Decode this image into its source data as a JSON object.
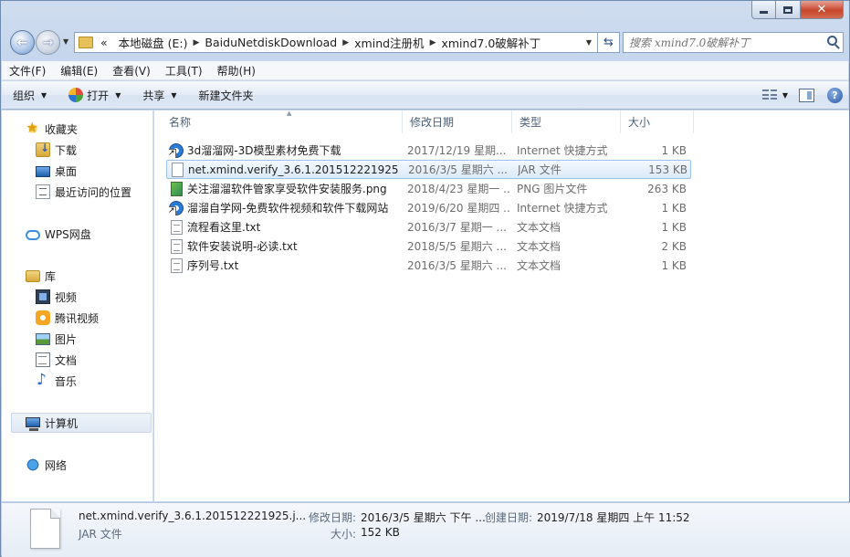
{
  "window": {
    "caption_min": "",
    "caption_max": "",
    "caption_close": "✕"
  },
  "address": {
    "overflow": "«",
    "segments": [
      "本地磁盘 (E:)",
      "BaiduNetdiskDownload",
      "xmind注册机",
      "xmind7.0破解补丁"
    ]
  },
  "search": {
    "placeholder": "搜索 xmind7.0破解补丁"
  },
  "menu": [
    "文件(F)",
    "编辑(E)",
    "查看(V)",
    "工具(T)",
    "帮助(H)"
  ],
  "toolbar": {
    "organize": "组织",
    "open": "打开",
    "share": "共享",
    "new_folder": "新建文件夹",
    "help": "?"
  },
  "navpane": {
    "favorites": "收藏夹",
    "downloads": "下载",
    "desktop": "桌面",
    "recent": "最近访问的位置",
    "wps": "WPS网盘",
    "libraries": "库",
    "videos": "视频",
    "tencent_video": "腾讯视频",
    "pictures": "图片",
    "documents": "文档",
    "music": "音乐",
    "computer": "计算机",
    "network": "网络"
  },
  "columns": {
    "name": "名称",
    "date": "修改日期",
    "type": "类型",
    "size": "大小"
  },
  "files": [
    {
      "name": "3d溜溜网-3D模型素材免费下载",
      "date": "2017/12/19 星期...",
      "type": "Internet 快捷方式",
      "size": "1 KB",
      "icon": "url-shortcut-icon"
    },
    {
      "name": "net.xmind.verify_3.6.1.201512221925.j...",
      "date": "2016/3/5 星期六 ...",
      "type": "JAR 文件",
      "size": "153 KB",
      "icon": "jar-file-icon"
    },
    {
      "name": "关注溜溜软件管家享受软件安装服务.png",
      "date": "2018/4/23 星期一 ...",
      "type": "PNG 图片文件",
      "size": "263 KB",
      "icon": "png-file-icon"
    },
    {
      "name": "溜溜自学网-免费软件视频和软件下载网站",
      "date": "2019/6/20 星期四 ...",
      "type": "Internet 快捷方式",
      "size": "1 KB",
      "icon": "url-shortcut-icon"
    },
    {
      "name": "流程看这里.txt",
      "date": "2016/3/7 星期一 ...",
      "type": "文本文档",
      "size": "1 KB",
      "icon": "txt-file-icon"
    },
    {
      "name": "软件安装说明-必读.txt",
      "date": "2018/5/5 星期六 ...",
      "type": "文本文档",
      "size": "2 KB",
      "icon": "txt-file-icon"
    },
    {
      "name": "序列号.txt",
      "date": "2016/3/5 星期六 ...",
      "type": "文本文档",
      "size": "1 KB",
      "icon": "txt-file-icon"
    }
  ],
  "details": {
    "filename": "net.xmind.verify_3.6.1.201512221925.j...",
    "filetype": "JAR 文件",
    "modified_label": "修改日期:",
    "modified_value": "2016/3/5 星期六 下午 ...",
    "created_label": "创建日期:",
    "created_value": "2019/7/18 星期四 上午 11:52",
    "size_label": "大小:",
    "size_value": "152 KB"
  }
}
